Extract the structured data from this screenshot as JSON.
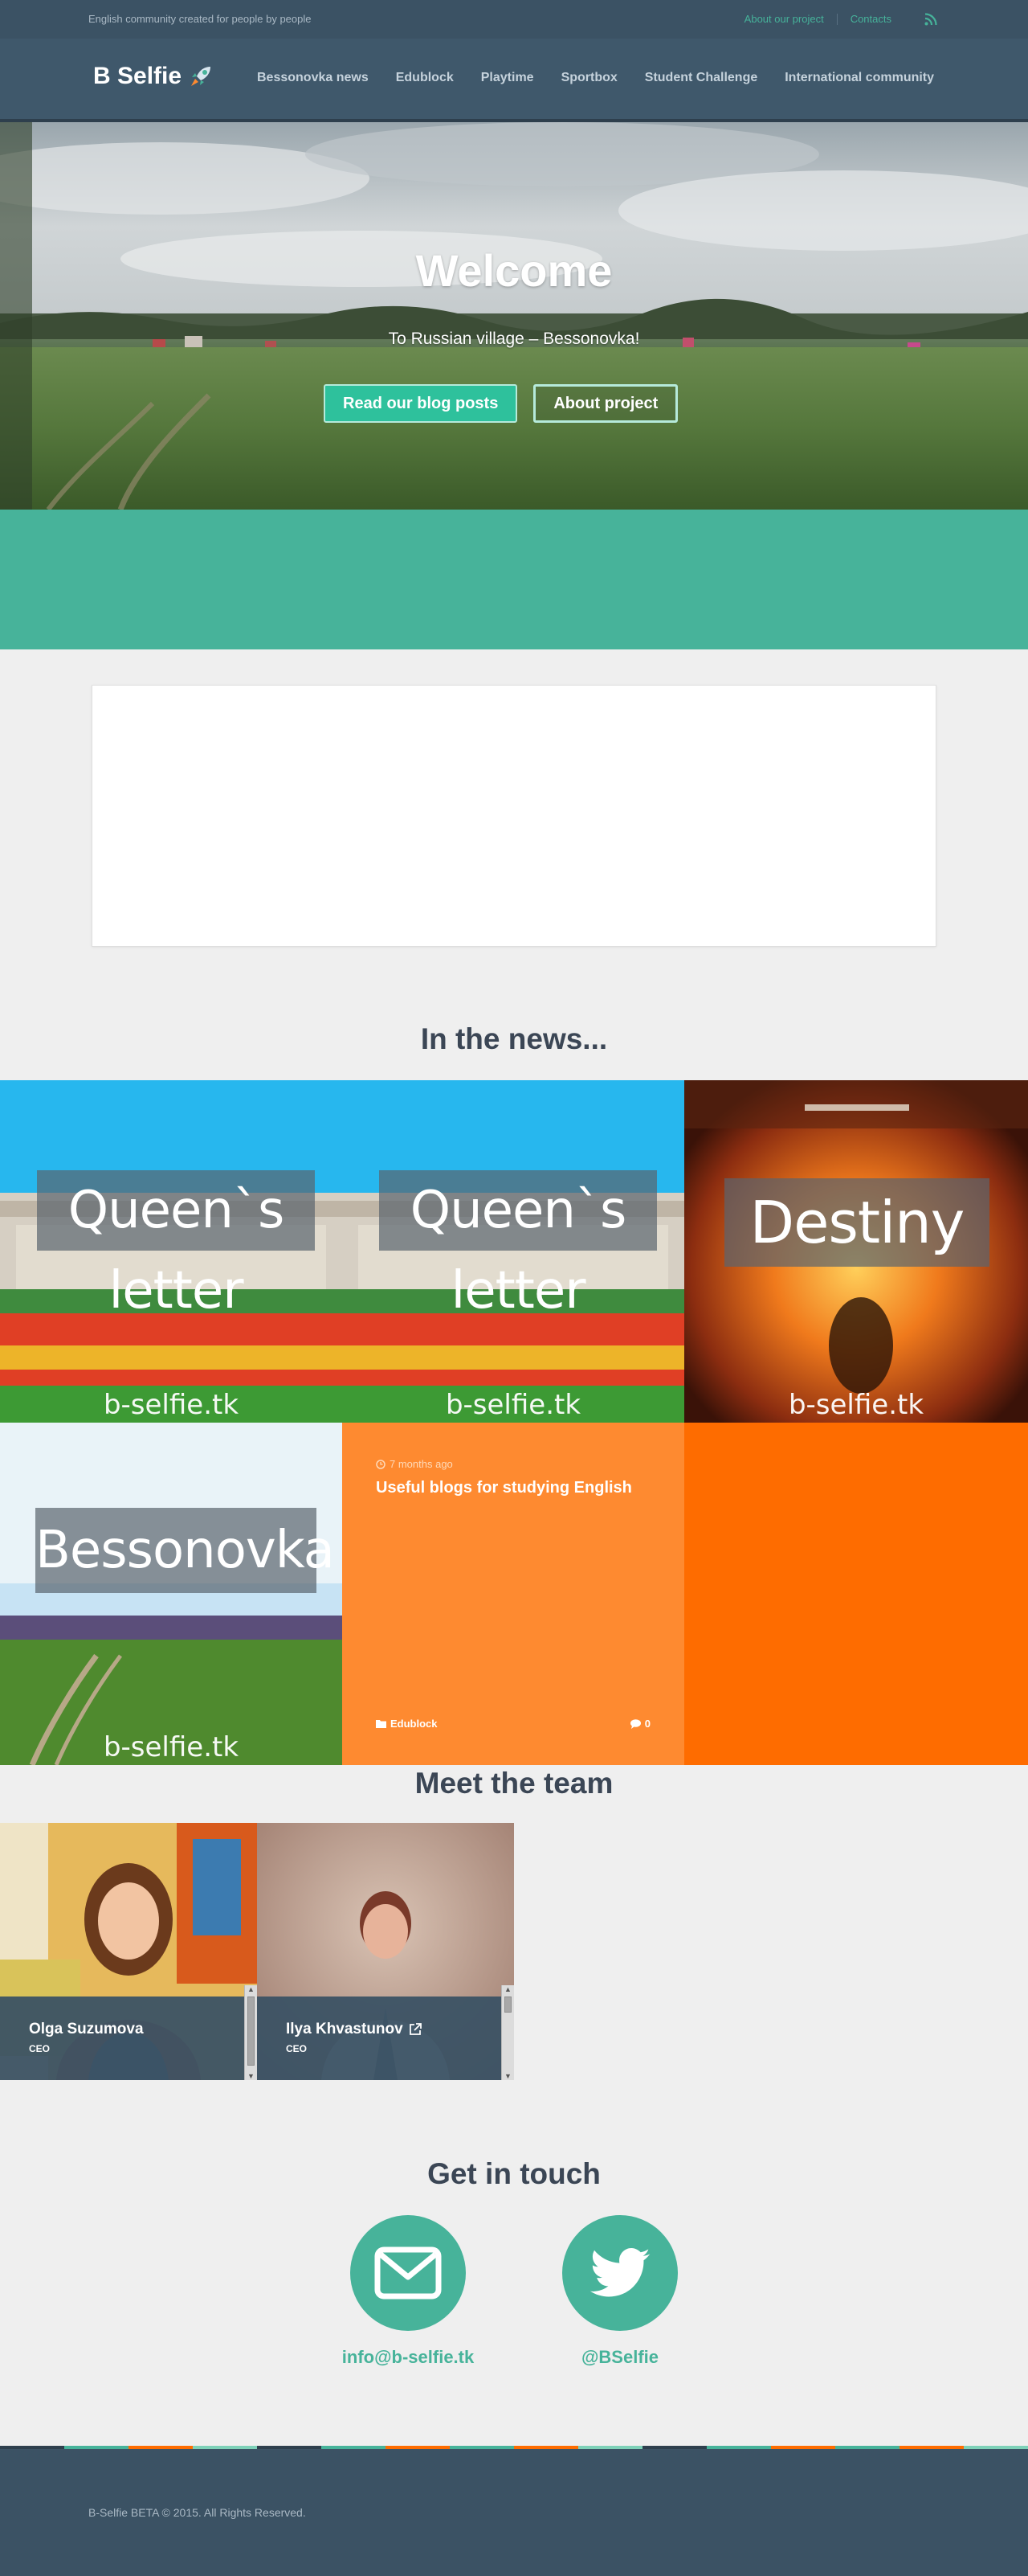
{
  "topbar": {
    "tagline": "English community created for people by people",
    "links": [
      "About our project",
      "Contacts"
    ]
  },
  "nav": {
    "brand": "B Selfie",
    "items": [
      "Bessonovka news",
      "Edublock",
      "Playtime",
      "Sportbox",
      "Student Challenge",
      "International community"
    ]
  },
  "hero": {
    "title": "Welcome",
    "subtitle": "To Russian village – Bessonovka!",
    "primary_button": "Read our blog posts",
    "secondary_button": "About project"
  },
  "news": {
    "title": "In the news...",
    "tiles": [
      {
        "caption": "Queen`s letter",
        "watermark": "b-selfie.tk"
      },
      {
        "caption": "Queen`s letter",
        "watermark": "b-selfie.tk"
      },
      {
        "caption": "Destiny",
        "watermark": "b-selfie.tk"
      },
      {
        "caption": "Bessonovka",
        "watermark": "b-selfie.tk"
      }
    ],
    "card": {
      "time": "7 months ago",
      "title": "Useful blogs for studying English",
      "category": "Edublock",
      "comments": "0"
    }
  },
  "team": {
    "title": "Meet the team",
    "members": [
      {
        "name": "Olga Suzumova",
        "role": "CEO"
      },
      {
        "name": "Ilya Khvastunov",
        "role": "CEO"
      }
    ]
  },
  "contact": {
    "title": "Get in touch",
    "email": "info@b-selfie.tk",
    "twitter": "@BSelfie"
  },
  "footer": {
    "copyright": "B-Selfie BETA © 2015. All Rights Reserved."
  },
  "colors": {
    "accent": "#47b39a",
    "dark": "#3b5264",
    "orange": "#fe6c00"
  }
}
